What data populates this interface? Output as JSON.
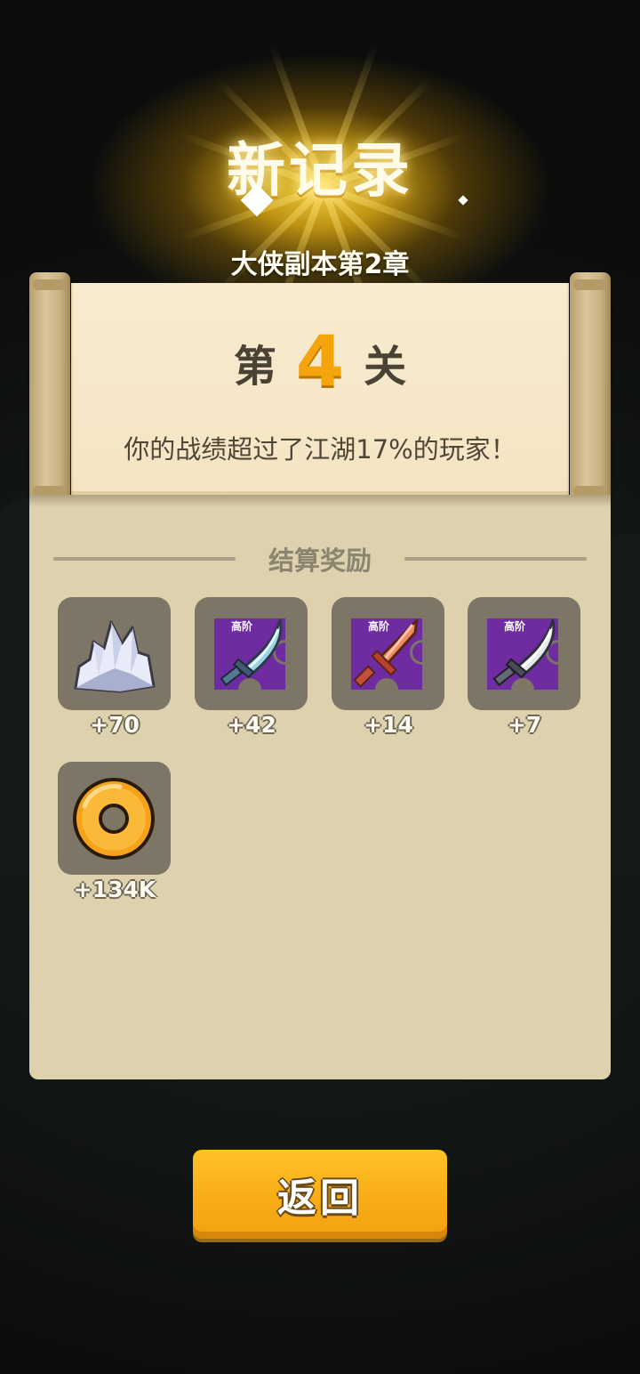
{
  "header": {
    "title": "新记录",
    "chapter": "大侠副本第2章"
  },
  "stage": {
    "prefix": "第",
    "number": "4",
    "suffix": "关",
    "description": "你的战绩超过了江湖17%的玩家！"
  },
  "rewards": {
    "title": "结算奖励",
    "items": [
      {
        "icon": "crystal-icon",
        "count": "+70"
      },
      {
        "icon": "saber-fragment-icon",
        "badge": "高阶",
        "count": "+42"
      },
      {
        "icon": "sword-fragment-icon",
        "badge": "高阶",
        "count": "+14"
      },
      {
        "icon": "saber-fragment-icon",
        "badge": "高阶",
        "count": "+7"
      },
      {
        "icon": "coin-icon",
        "count": "+134K"
      }
    ]
  },
  "buttons": {
    "back": "返回"
  },
  "colors": {
    "accent": "#f4a40d",
    "button": "#f9ad17",
    "fragment_bg": "#6e2ca0",
    "paper": "#f8ebcf",
    "panel": "#ded1ad"
  }
}
